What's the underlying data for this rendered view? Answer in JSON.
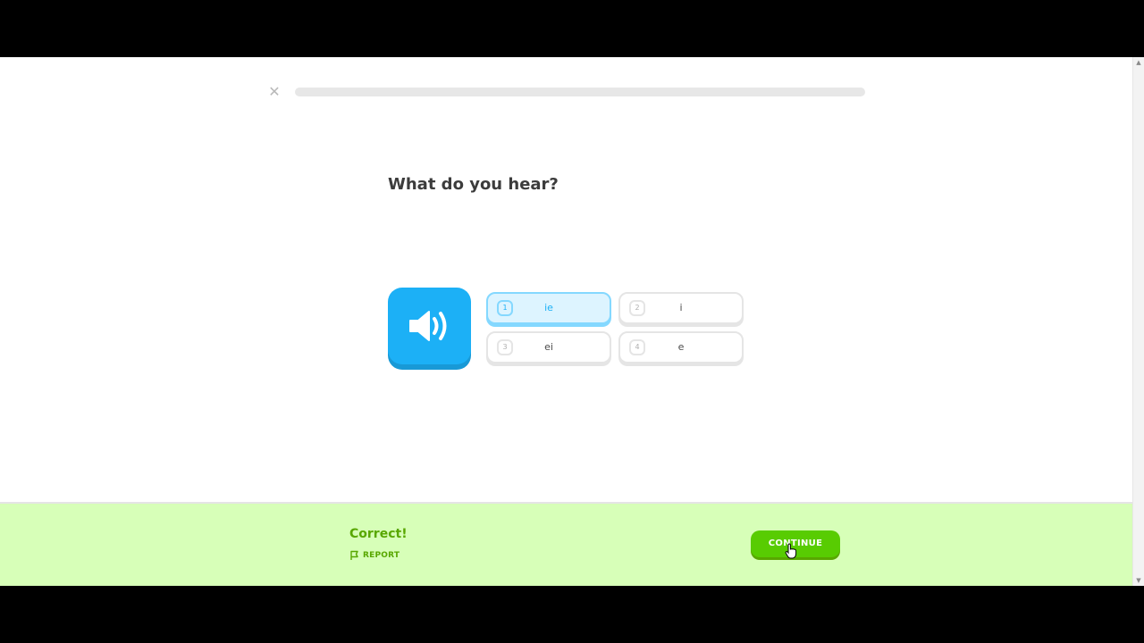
{
  "header": {
    "close_icon": "close-icon",
    "progress": 0.0,
    "progress_color": "#58cc02"
  },
  "challenge": {
    "prompt": "What do you hear?",
    "speaker_icon": "speaker-icon",
    "options": [
      {
        "key": "1",
        "text": "ie",
        "selected": true
      },
      {
        "key": "2",
        "text": "i",
        "selected": false
      },
      {
        "key": "3",
        "text": "ei",
        "selected": false
      },
      {
        "key": "4",
        "text": "e",
        "selected": false
      }
    ]
  },
  "footer": {
    "result": "Correct!",
    "report_label": "REPORT",
    "report_icon": "flag-icon",
    "continue_label": "CONTINUE"
  },
  "colors": {
    "speaker_blue": "#1cb0f6",
    "selected_bg": "#ddf4ff",
    "footer_bg": "#d7ffb8",
    "correct_green": "#58a700",
    "button_green": "#58cc02"
  }
}
